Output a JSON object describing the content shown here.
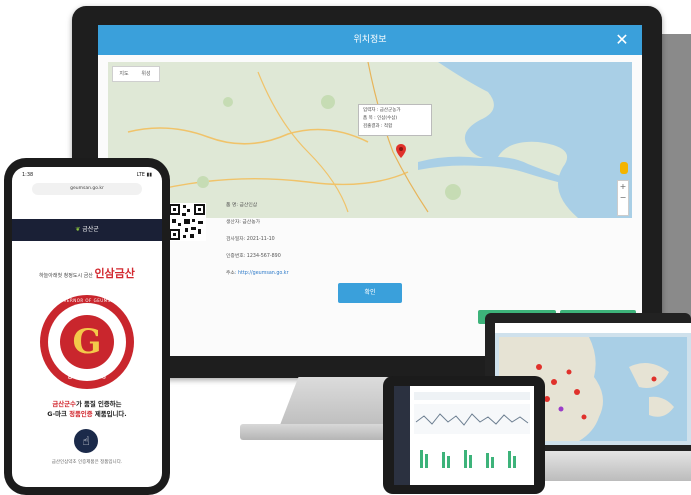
{
  "desktop": {
    "modal_title": "위치정보",
    "close_label": "✕",
    "map_toggle": [
      "지도",
      "위성"
    ],
    "map_popup": [
      "입력자 : 금산군농가",
      "품 목 : 인삼(수삼)",
      "검출결과 : 적합"
    ],
    "info_rows": [
      {
        "label": "품 명",
        "value": ": 금산인삼"
      },
      {
        "label": "생산자",
        "value": ": 금산농가"
      },
      {
        "label": "검사일자",
        "value": ": 2021-11-10"
      },
      {
        "label": "인증번호",
        "value": ": 1234-567-890"
      },
      {
        "label": "주소",
        "value": ": http://geumsan.go.kr"
      }
    ],
    "confirm_label": "확인",
    "green_buttons": [
      "생산이력 조회",
      "인증정보 조회"
    ]
  },
  "phone": {
    "status_time": "1:38",
    "status_right": "LTE ▮▮",
    "url": "geumsan.go.kr",
    "nav_title": "금산군",
    "slogan_prefix": "하늘아래첫 청정도시 금산",
    "slogan_brand": "인삼금산",
    "seal_top": "GOVERNOR OF GEUMSAN",
    "seal_letter": "G",
    "seal_bottom": "금산군수 품질인증",
    "msg_line1_hl": "금산군수",
    "msg_line1": "가 품질 인증하는",
    "msg_line2_pre": "G-마크 ",
    "msg_line2_hl": "정품인증",
    "msg_line2_post": " 제품입니다.",
    "hand_icon": "☝",
    "foot": "금산인삼약초 인증제품은 정품입니다."
  },
  "colors": {
    "header_blue": "#3aa0db",
    "green": "#3db37a",
    "seal_red": "#c9262d",
    "navy": "#1a2036"
  }
}
